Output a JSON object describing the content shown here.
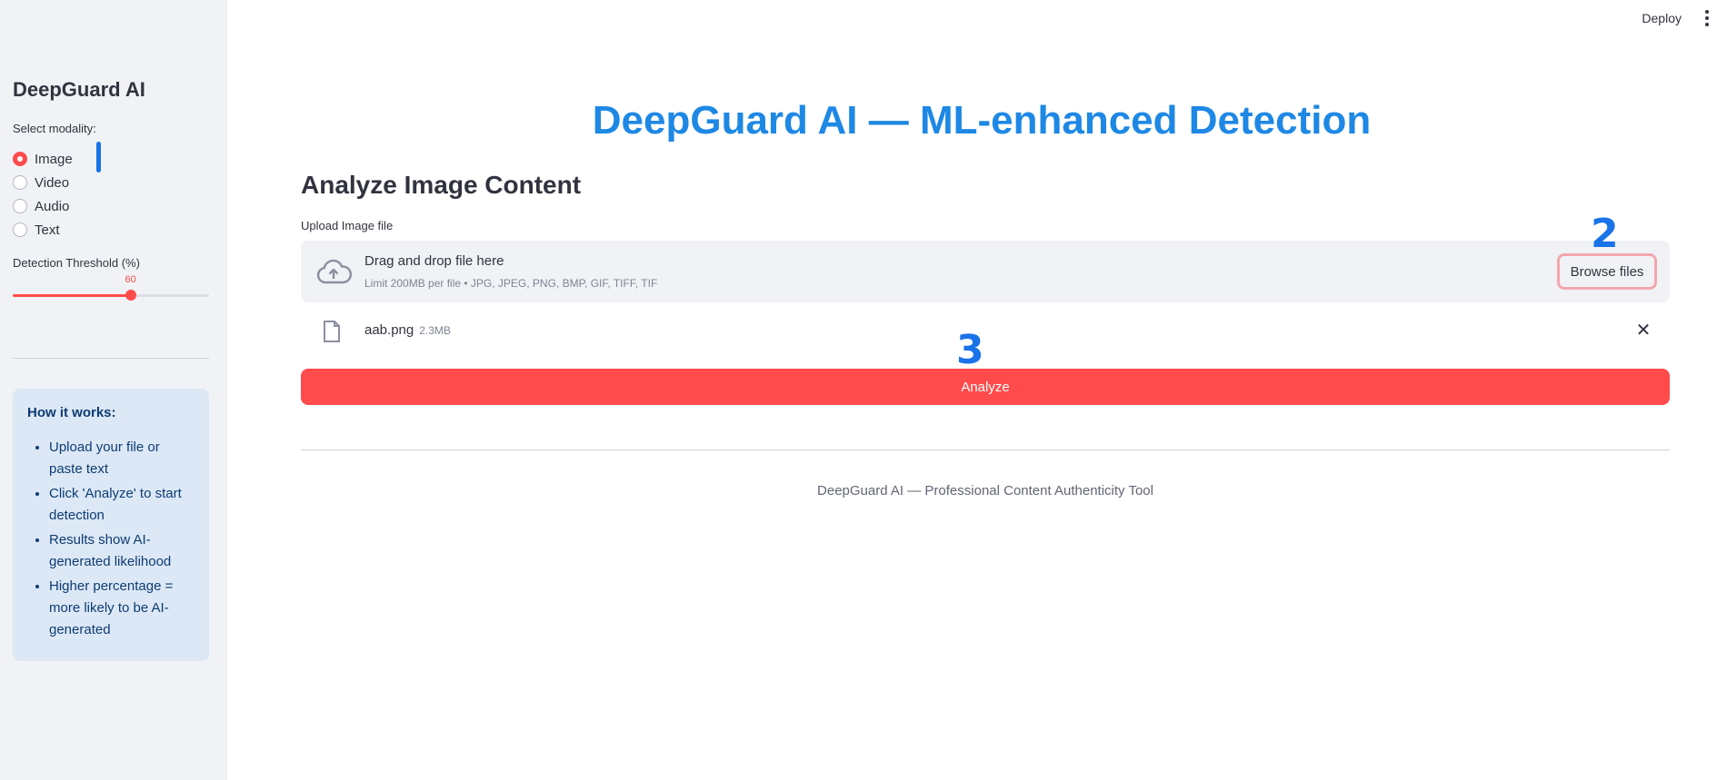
{
  "sidebar": {
    "title": "DeepGuard AI",
    "modality_label": "Select modality:",
    "modalities": [
      {
        "label": "Image",
        "selected": true
      },
      {
        "label": "Video",
        "selected": false
      },
      {
        "label": "Audio",
        "selected": false
      },
      {
        "label": "Text",
        "selected": false
      }
    ],
    "threshold_label": "Detection Threshold (%)",
    "threshold_value": "60",
    "threshold_fraction": 0.6,
    "info": {
      "title": "How it works:",
      "items": [
        "Upload your file or paste text",
        "Click 'Analyze' to start detection",
        "Results show AI-generated likelihood",
        "Higher percentage = more likely to be AI-generated"
      ]
    }
  },
  "topbar": {
    "deploy_label": "Deploy",
    "menu_icon": "vertical-dots-icon"
  },
  "main": {
    "title": "DeepGuard AI — ML-enhanced Detection",
    "section_title": "Analyze Image Content",
    "upload_label": "Upload Image file",
    "dropzone": {
      "icon": "cloud-upload-icon",
      "text": "Drag and drop file here",
      "limit": "Limit 200MB per file • JPG, JPEG, PNG, BMP, GIF, TIFF, TIF",
      "browse_label": "Browse files"
    },
    "file": {
      "icon": "file-icon",
      "name": "aab.png",
      "size": "2.3MB",
      "remove_icon": "close-icon"
    },
    "analyze_label": "Analyze",
    "footer": "DeepGuard AI — Professional Content Authenticity Tool"
  },
  "annotations": {
    "one": "1",
    "two": "2",
    "three": "3"
  },
  "colors": {
    "accent": "#ff4b4b",
    "title_blue": "#1e88e5",
    "sidebar_bg": "#f0f2f6",
    "info_bg": "#dce8f5",
    "annotation_blue": "#1a73e8"
  }
}
